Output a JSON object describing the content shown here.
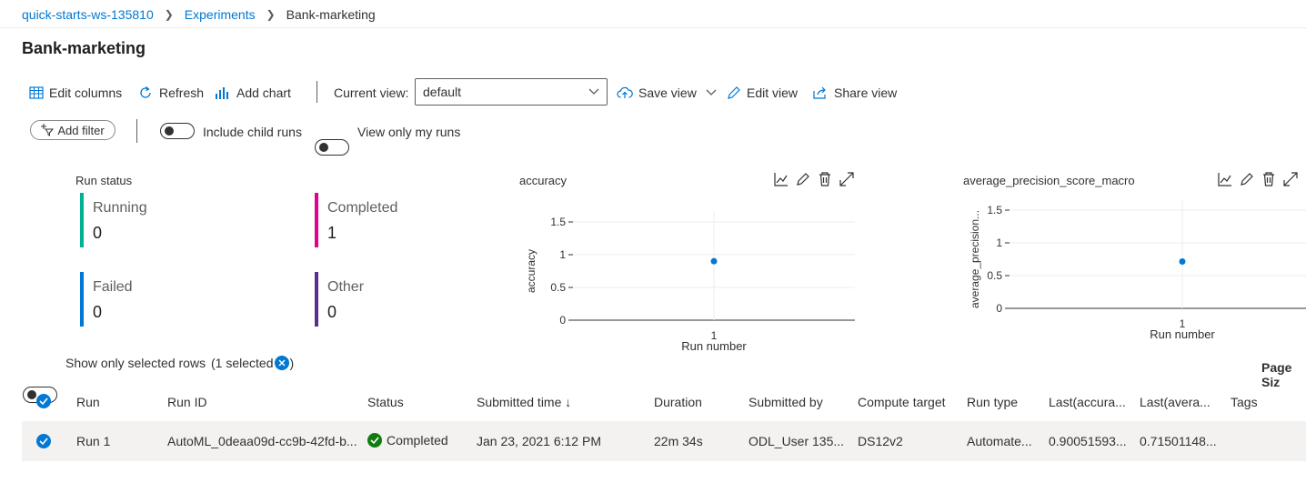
{
  "breadcrumb": {
    "workspace": "quick-starts-ws-135810",
    "experiments": "Experiments",
    "current": "Bank-marketing"
  },
  "page_title": "Bank-marketing",
  "toolbar": {
    "edit_columns": "Edit columns",
    "refresh": "Refresh",
    "add_chart": "Add chart",
    "current_view_label": "Current view:",
    "current_view_value": "default",
    "save_view": "Save view",
    "edit_view": "Edit view",
    "share_view": "Share view"
  },
  "filters": {
    "add_filter": "Add filter",
    "include_child_runs": "Include child runs",
    "view_only_my_runs": "View only my runs"
  },
  "run_status": {
    "title": "Run status",
    "items": [
      {
        "label": "Running",
        "value": "0",
        "color": "#00b294"
      },
      {
        "label": "Completed",
        "value": "1",
        "color": "#e3008c"
      },
      {
        "label": "Failed",
        "value": "0",
        "color": "#0078d4"
      },
      {
        "label": "Other",
        "value": "0",
        "color": "#5c2d91"
      }
    ]
  },
  "chart_data": [
    {
      "type": "scatter",
      "title": "accuracy",
      "xlabel": "Run number",
      "ylabel": "accuracy",
      "x": [
        1
      ],
      "y": [
        0.9005
      ],
      "yticks": [
        "0",
        "0.5",
        "1",
        "1.5"
      ],
      "xticks": [
        "1"
      ],
      "ylim": [
        0,
        1.5
      ],
      "color": "#0078d4"
    },
    {
      "type": "scatter",
      "title": "average_precision_score_macro",
      "xlabel": "Run number",
      "ylabel": "average_precision...",
      "x": [
        1
      ],
      "y": [
        0.715
      ],
      "yticks": [
        "0",
        "0.5",
        "1",
        "1.5"
      ],
      "xticks": [
        "1"
      ],
      "ylim": [
        0,
        1.5
      ],
      "color": "#0078d4"
    }
  ],
  "selection": {
    "show_only_selected": "Show only selected rows",
    "selected_count": "(1 selected",
    "selected_close": ")"
  },
  "page_size_label": "Page Siz",
  "table": {
    "headers": {
      "run": "Run",
      "run_id": "Run ID",
      "status": "Status",
      "submitted_time": "Submitted time ↓",
      "duration": "Duration",
      "submitted_by": "Submitted by",
      "compute_target": "Compute target",
      "run_type": "Run type",
      "last_accuracy": "Last(accura...",
      "last_average": "Last(avera...",
      "tags": "Tags"
    },
    "rows": [
      {
        "run": "Run 1",
        "run_id": "AutoML_0deaa09d-cc9b-42fd-b...",
        "status": "Completed",
        "submitted_time": "Jan 23, 2021 6:12 PM",
        "duration": "22m 34s",
        "submitted_by": "ODL_User 135...",
        "compute_target": "DS12v2",
        "run_type": "Automate...",
        "last_accuracy": "0.90051593...",
        "last_average": "0.71501148...",
        "tags": ""
      }
    ]
  }
}
